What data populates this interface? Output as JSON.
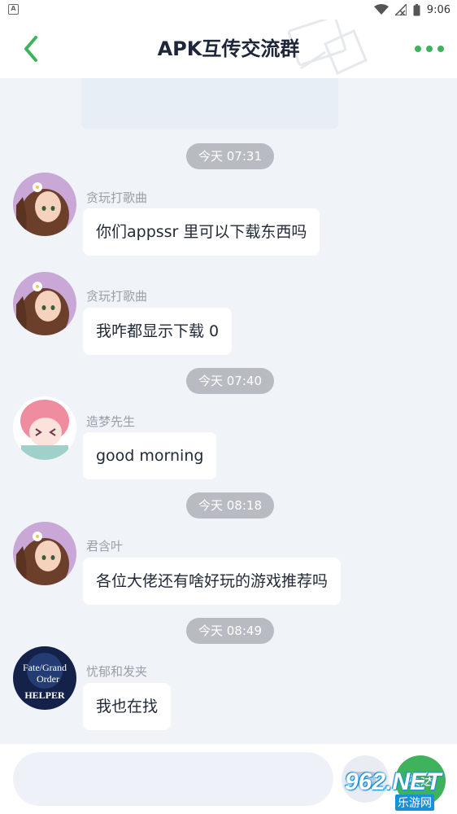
{
  "status_bar": {
    "time": "9:06",
    "left_icon_letter": "A"
  },
  "header": {
    "title": "APK互传交流群"
  },
  "colors": {
    "accent": "#3fb35b",
    "time_pill": "#b8bcc2",
    "bg": "#f0f3f8"
  },
  "messages": [
    {
      "type": "time",
      "text": "今天 07:31"
    },
    {
      "type": "msg",
      "sender": "贪玩打歌曲",
      "text": "你们appssr 里可以下载东西吗",
      "avatar": "anime-girl-flower-avatar"
    },
    {
      "type": "msg",
      "sender": "贪玩打歌曲",
      "text": "我咋都显示下载 0",
      "avatar": "anime-girl-flower-avatar"
    },
    {
      "type": "time",
      "text": "今天 07:40"
    },
    {
      "type": "msg",
      "sender": "造梦先生",
      "text": "good morning",
      "avatar": "pink-hair-girl-avatar"
    },
    {
      "type": "time",
      "text": "今天 08:18"
    },
    {
      "type": "msg",
      "sender": "君含叶",
      "text": "各位大佬还有啥好玩的游戏推荐吗",
      "avatar": "anime-girl-flower-avatar"
    },
    {
      "type": "time",
      "text": "今天 08:49"
    },
    {
      "type": "msg",
      "sender": "忧郁和发夹",
      "text": "我也在找",
      "avatar": "fate-grand-order-avatar"
    }
  ],
  "avatar_text": {
    "fgo_line1": "Fate/Grand",
    "fgo_line2": "Order",
    "fgo_line3": "HELPER"
  },
  "input": {
    "placeholder": "",
    "value": ""
  },
  "send_label": "发送",
  "watermark": {
    "brand": "962.NET",
    "sub": "乐游网"
  }
}
